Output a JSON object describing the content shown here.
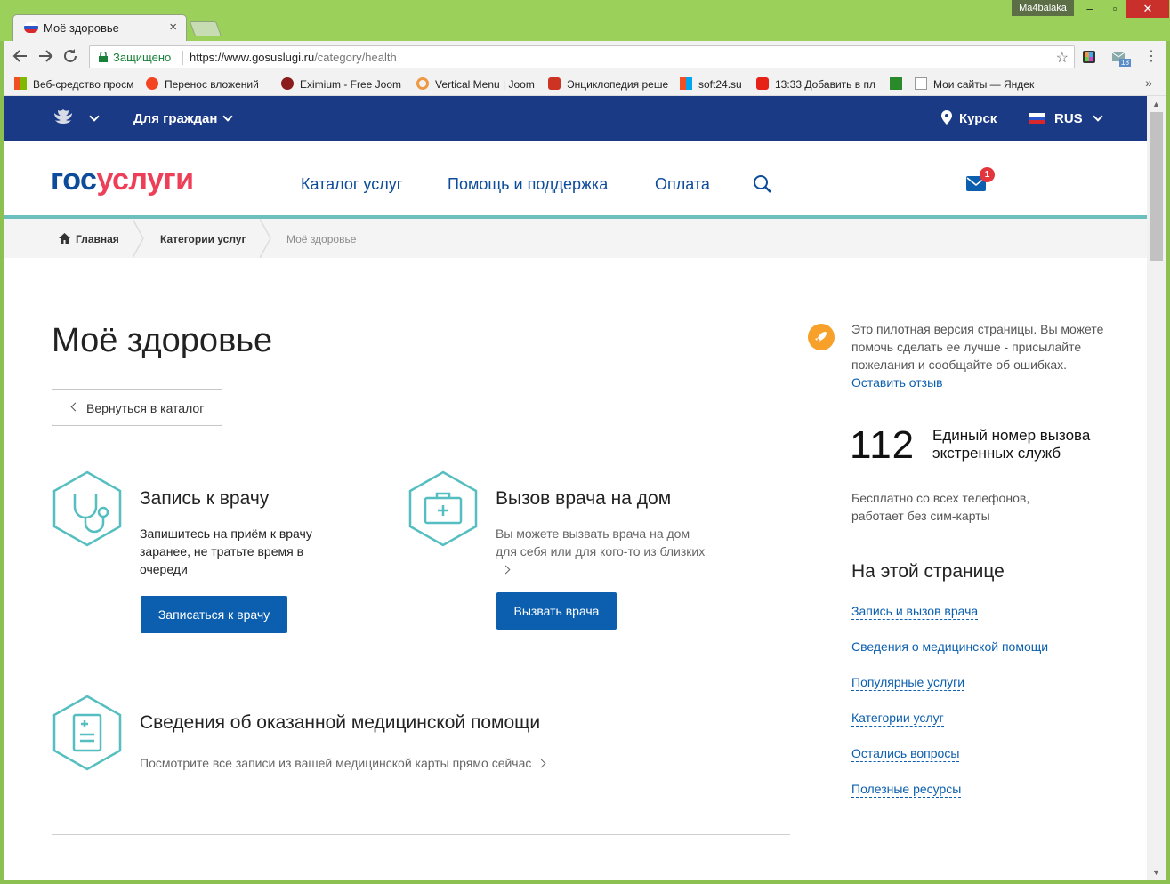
{
  "browser": {
    "tab_title": "Моё здоровье",
    "tab_close": "×",
    "user": "Ma4balaka",
    "window_min": "–",
    "window_max": "▫",
    "window_close": "✕",
    "secure_label": "Защищено",
    "url_host": "https://www.gosuslugi.ru",
    "url_path": "/category/health",
    "bookmarks": [
      "Веб-средство просм",
      "Перенос вложений",
      "Eximium - Free Joom",
      "Vertical Menu | Joom",
      "Энциклопедия реше",
      "soft24.su",
      "13:33 Добавить в пл",
      "",
      "Мои сайты — Яндек"
    ],
    "bookmarks_more": "»",
    "ext_badge": "18"
  },
  "topbar": {
    "citizens": "Для граждан",
    "city": "Курск",
    "lang": "RUS"
  },
  "header": {
    "logo_gos": "гос",
    "logo_uslugi": "услуги",
    "nav": [
      "Каталог услуг",
      "Помощь и поддержка",
      "Оплата"
    ],
    "mail_count": "1"
  },
  "breadcrumbs": [
    "Главная",
    "Категории услуг",
    "Моё здоровье"
  ],
  "page": {
    "title": "Моё здоровье",
    "back_label": "Вернуться в каталог",
    "cards": [
      {
        "title": "Запись к врачу",
        "desc": "Запишитесь на приём к врачу заранее, не тратьте время в очереди",
        "button": "Записаться к врачу",
        "icon": "stethoscope-icon"
      },
      {
        "title": "Вызов врача на дом",
        "desc": "Вы можете вызвать врача на дом для себя или для кого-то из близких",
        "button": "Вызвать врача",
        "icon": "medical-kit-icon"
      },
      {
        "title": "Сведения об оказанной медицинской помощи",
        "desc": "Посмотрите все записи из вашей медицинской карты прямо сейчас",
        "icon": "medical-record-icon"
      }
    ]
  },
  "sidebar": {
    "pilot_text": "Это пилотная версия страницы. Вы можете помочь сделать ее лучше - присылайте пожелания и сообщайте об ошибках.",
    "pilot_link": "Оставить отзыв",
    "emergency_number": "112",
    "emergency_label": "Единый номер вызова экстренных служб",
    "emergency_note": "Бесплатно со всех телефонов, работает без сим-карты",
    "onpage_title": "На этой странице",
    "toc": [
      "Запись и вызов врача",
      "Сведения о медицинской помощи",
      "Популярные услуги",
      "Категории услуг",
      "Остались вопросы",
      "Полезные ресурсы"
    ]
  },
  "colors": {
    "brand_blue": "#0d4c9a",
    "brand_red": "#ee3f58",
    "topbar": "#1b3a85",
    "teal": "#6bbfbd",
    "button": "#0b5fae"
  }
}
